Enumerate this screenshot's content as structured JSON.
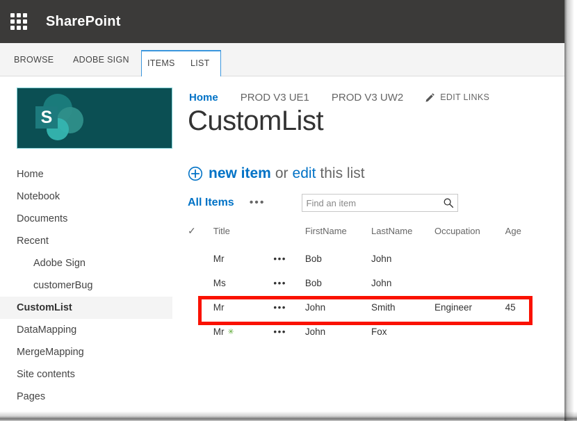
{
  "suite": {
    "app_launcher_icon": "waffle-grid-icon",
    "title": "SharePoint"
  },
  "ribbon": {
    "tabs": [
      {
        "label": "BROWSE",
        "active": false
      },
      {
        "label": "ADOBE SIGN",
        "active": false
      },
      {
        "label": "ITEMS",
        "active": true
      },
      {
        "label": "LIST",
        "active": true
      }
    ]
  },
  "site_logo": {
    "letter": "S",
    "background_color": "#0b4f53",
    "accent_color": "#2a8f8f"
  },
  "topnav": {
    "links": [
      {
        "label": "Home",
        "selected": true
      },
      {
        "label": "PROD V3 UE1",
        "selected": false
      },
      {
        "label": "PROD V3 UW2",
        "selected": false
      }
    ],
    "edit_links_label": "EDIT LINKS",
    "edit_links_icon": "pencil-icon"
  },
  "page_title": "CustomList",
  "sidebar": {
    "items": [
      {
        "label": "Home",
        "child": false,
        "current": false
      },
      {
        "label": "Notebook",
        "child": false,
        "current": false
      },
      {
        "label": "Documents",
        "child": false,
        "current": false
      },
      {
        "label": "Recent",
        "child": false,
        "current": false
      },
      {
        "label": "Adobe Sign",
        "child": true,
        "current": false
      },
      {
        "label": "customerBug",
        "child": true,
        "current": false
      },
      {
        "label": "CustomList",
        "child": false,
        "current": true
      },
      {
        "label": "DataMapping",
        "child": false,
        "current": false
      },
      {
        "label": "MergeMapping",
        "child": false,
        "current": false
      },
      {
        "label": "Site contents",
        "child": false,
        "current": false
      },
      {
        "label": "Pages",
        "child": false,
        "current": false
      }
    ]
  },
  "command_bar": {
    "new_item_icon": "circle-plus-icon",
    "new_item_label": "new item",
    "or_label": "or",
    "edit_label": "edit",
    "this_list_label": "this list"
  },
  "view_bar": {
    "view_name": "All Items",
    "view_ellipsis": "•••",
    "search_placeholder": "Find an item",
    "search_value": "",
    "search_icon": "magnifier-icon"
  },
  "list": {
    "columns": [
      "Title",
      "FirstName",
      "LastName",
      "Occupation",
      "Age"
    ],
    "select_all_icon": "checkmark-icon",
    "row_menu_glyph": "•••",
    "rows": [
      {
        "title": "Mr",
        "firstname": "Bob",
        "lastname": "John",
        "occupation": "",
        "age": "",
        "new_badge": "",
        "highlighted": false
      },
      {
        "title": "Ms",
        "firstname": "Bob",
        "lastname": "John",
        "occupation": "",
        "age": "",
        "new_badge": "",
        "highlighted": false
      },
      {
        "title": "Mr",
        "firstname": "John",
        "lastname": "Smith",
        "occupation": "Engineer",
        "age": "45",
        "new_badge": "",
        "highlighted": true
      },
      {
        "title": "Mr",
        "firstname": "John",
        "lastname": "Fox",
        "occupation": "",
        "age": "",
        "new_badge": "✳",
        "highlighted": false
      }
    ]
  },
  "annotation": {
    "highlight_color": "#fa1100",
    "highlight_target_row_index": 2
  }
}
